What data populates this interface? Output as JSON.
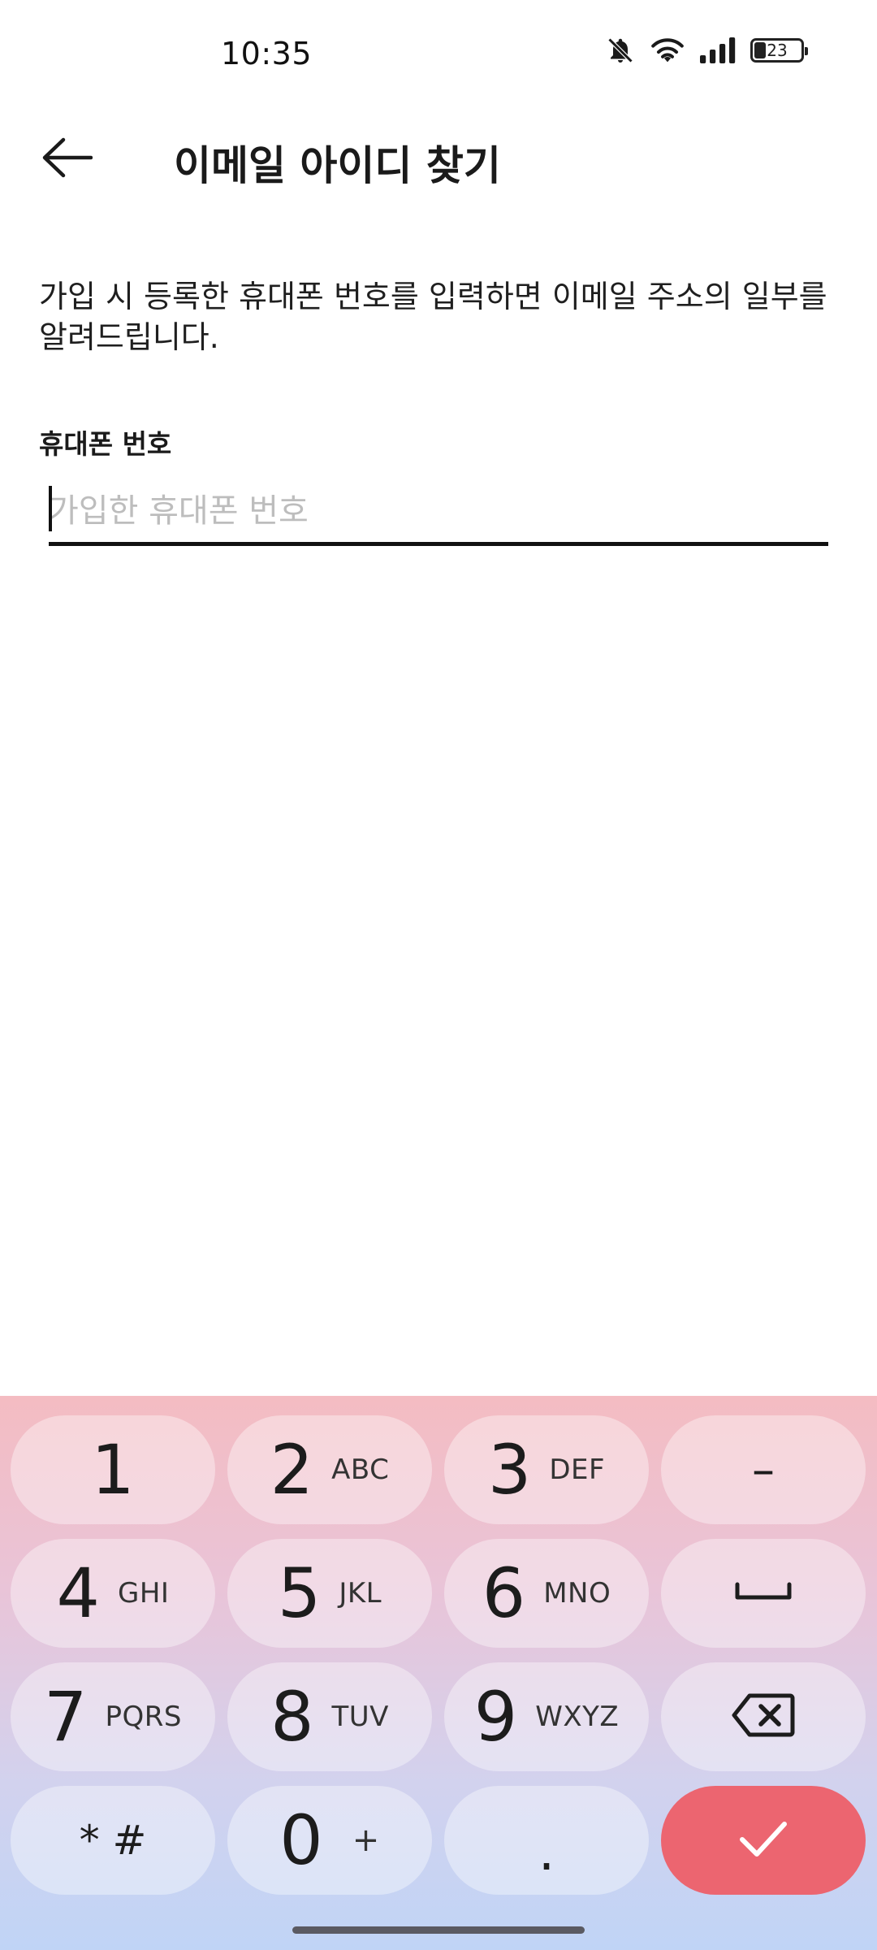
{
  "status_bar": {
    "time": "10:35",
    "battery_level": "23",
    "icons": [
      "bell-off-icon",
      "wifi-icon",
      "signal-icon",
      "battery-icon"
    ]
  },
  "header": {
    "title": "이메일 아이디 찾기",
    "back_icon": "arrow-left-icon"
  },
  "main": {
    "description": "가입 시 등록한 휴대폰 번호를 입력하면 이메일 주소의 일부를 알려드립니다.",
    "phone_label": "휴대폰 번호",
    "phone_value": "",
    "phone_placeholder": "가입한 휴대폰 번호"
  },
  "keyboard": {
    "colors": {
      "background_top": "#f4bcc2",
      "background_bottom": "#c0d4f6",
      "done": "#ec6570"
    },
    "keys": [
      {
        "main": "1",
        "sub": ""
      },
      {
        "main": "2",
        "sub": "ABC"
      },
      {
        "main": "3",
        "sub": "DEF"
      },
      {
        "main": "–",
        "sub": ""
      },
      {
        "main": "4",
        "sub": "GHI"
      },
      {
        "main": "5",
        "sub": "JKL"
      },
      {
        "main": "6",
        "sub": "MNO"
      },
      {
        "main": "",
        "sub": "",
        "icon": "space-icon"
      },
      {
        "main": "7",
        "sub": "PQRS"
      },
      {
        "main": "8",
        "sub": "TUV"
      },
      {
        "main": "9",
        "sub": "WXYZ"
      },
      {
        "main": "",
        "sub": "",
        "icon": "backspace-icon"
      },
      {
        "main": "* #",
        "sub": ""
      },
      {
        "main": "0",
        "sub": "+"
      },
      {
        "main": ".",
        "sub": ""
      },
      {
        "main": "",
        "sub": "",
        "icon": "check-icon"
      }
    ]
  }
}
